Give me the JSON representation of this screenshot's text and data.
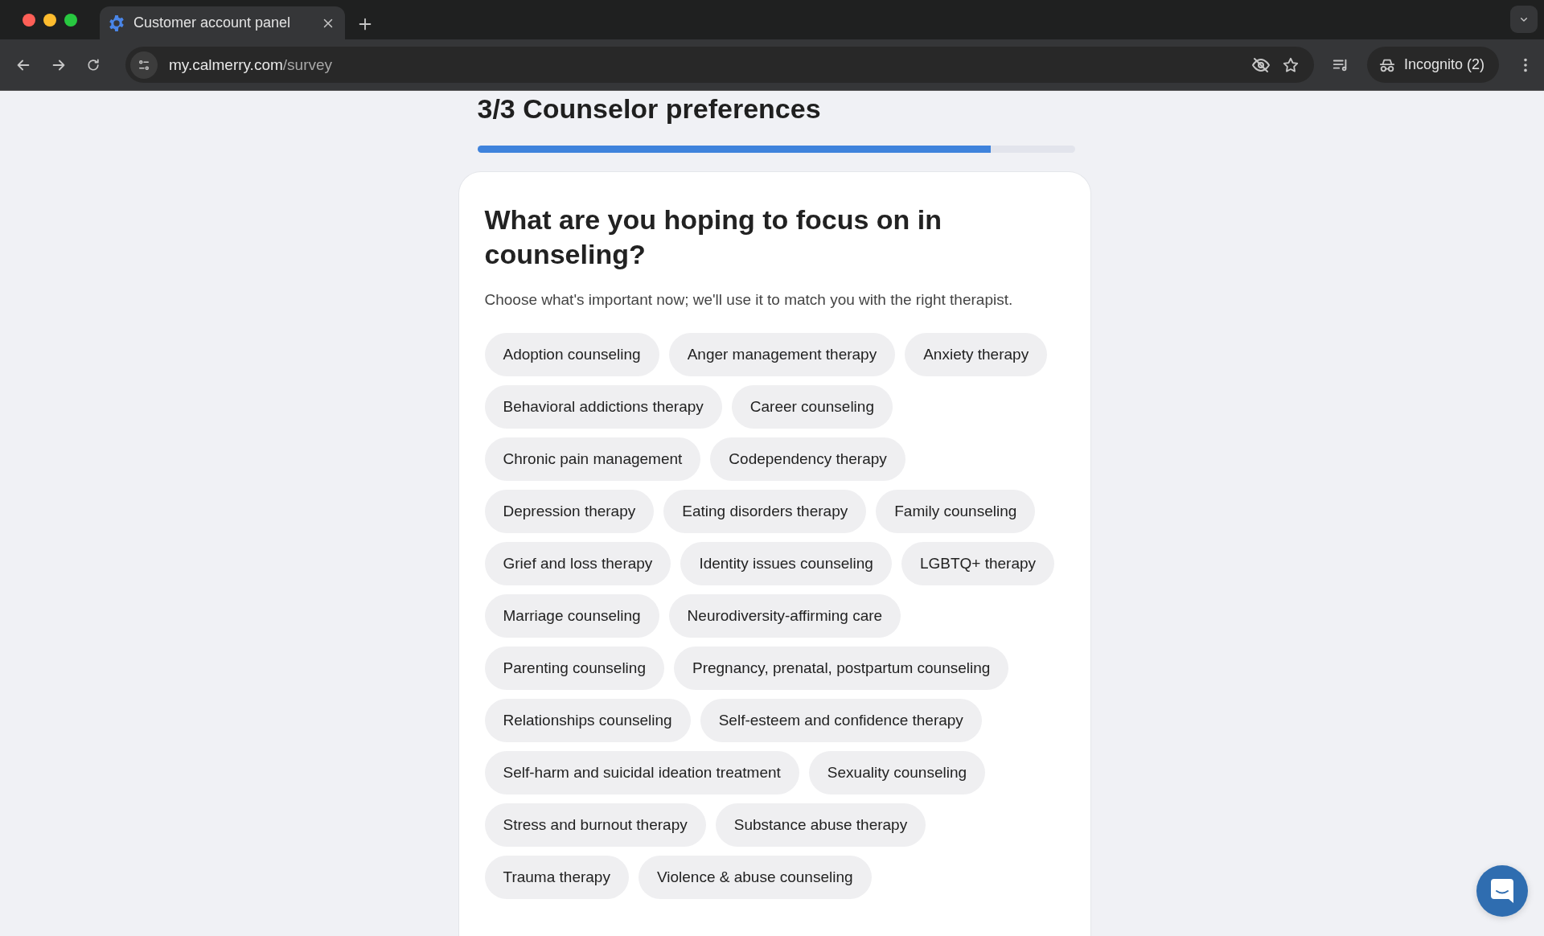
{
  "browser": {
    "tab": {
      "title": "Customer account panel",
      "selected": true
    },
    "url_host": "my.calmerry.com",
    "url_path": "/survey",
    "profile": "Incognito (2)"
  },
  "survey": {
    "step_title": "3/3 Counselor preferences",
    "progress": {
      "level": 0.86
    },
    "question": "What are you hoping to focus on in counseling?",
    "hint": "Choose what's important now; we'll use it to match you with the right therapist.",
    "option_rows": [
      [
        {
          "label": "Adoption counseling",
          "selected": false
        },
        {
          "label": "Anger management therapy",
          "selected": false
        },
        {
          "label": "Anxiety therapy",
          "selected": false
        }
      ],
      [
        {
          "label": "Behavioral addictions therapy",
          "selected": false
        },
        {
          "label": "Career counseling",
          "selected": false
        }
      ],
      [
        {
          "label": "Chronic pain management",
          "selected": false
        },
        {
          "label": "Codependency therapy",
          "selected": false
        }
      ],
      [
        {
          "label": "Depression therapy",
          "selected": false
        },
        {
          "label": "Eating disorders therapy",
          "selected": false
        },
        {
          "label": "Family counseling",
          "selected": false
        }
      ],
      [
        {
          "label": "Grief and loss therapy",
          "selected": false
        },
        {
          "label": "Identity issues counseling",
          "selected": false
        },
        {
          "label": "LGBTQ+ therapy",
          "selected": false
        }
      ],
      [
        {
          "label": "Marriage counseling",
          "selected": false
        },
        {
          "label": "Neurodiversity-affirming care",
          "selected": false
        }
      ],
      [
        {
          "label": "Parenting counseling",
          "selected": false
        },
        {
          "label": "Pregnancy, prenatal, postpartum counseling",
          "selected": false
        }
      ],
      [
        {
          "label": "Relationships counseling",
          "selected": false
        },
        {
          "label": "Self-esteem and confidence therapy",
          "selected": false
        }
      ],
      [
        {
          "label": "Self-harm and suicidal ideation treatment",
          "selected": false
        },
        {
          "label": "Sexuality counseling",
          "selected": false
        }
      ],
      [
        {
          "label": "Stress and burnout therapy",
          "selected": false
        },
        {
          "label": "Substance abuse therapy",
          "selected": false
        }
      ],
      [
        {
          "label": "Trauma therapy",
          "selected": false
        },
        {
          "label": "Violence & abuse counseling",
          "selected": false
        }
      ]
    ]
  }
}
